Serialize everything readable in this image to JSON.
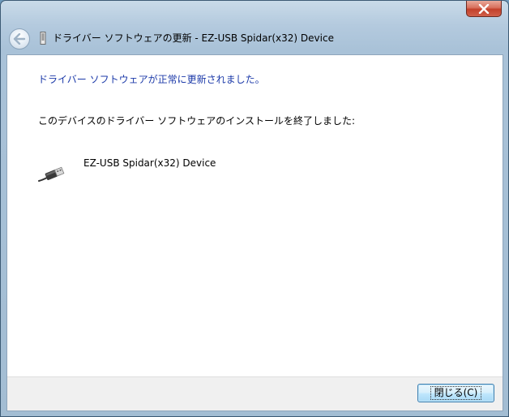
{
  "window": {
    "title": "ドライバー ソフトウェアの更新 - EZ-USB Spidar(x32) Device"
  },
  "content": {
    "heading": "ドライバー ソフトウェアが正常に更新されました。",
    "message": "このデバイスのドライバー ソフトウェアのインストールを終了しました:",
    "device_name": "EZ-USB Spidar(x32) Device"
  },
  "footer": {
    "close_label": "閉じる(C)"
  },
  "colors": {
    "heading": "#1c3aa9",
    "client_bg": "#ffffff",
    "footer_bg": "#f0f0f0",
    "close_button": "#c3402a"
  },
  "icons": {
    "close": "close-x-icon",
    "back": "back-arrow-icon",
    "title": "device-icon",
    "device": "usb-plug-icon"
  }
}
